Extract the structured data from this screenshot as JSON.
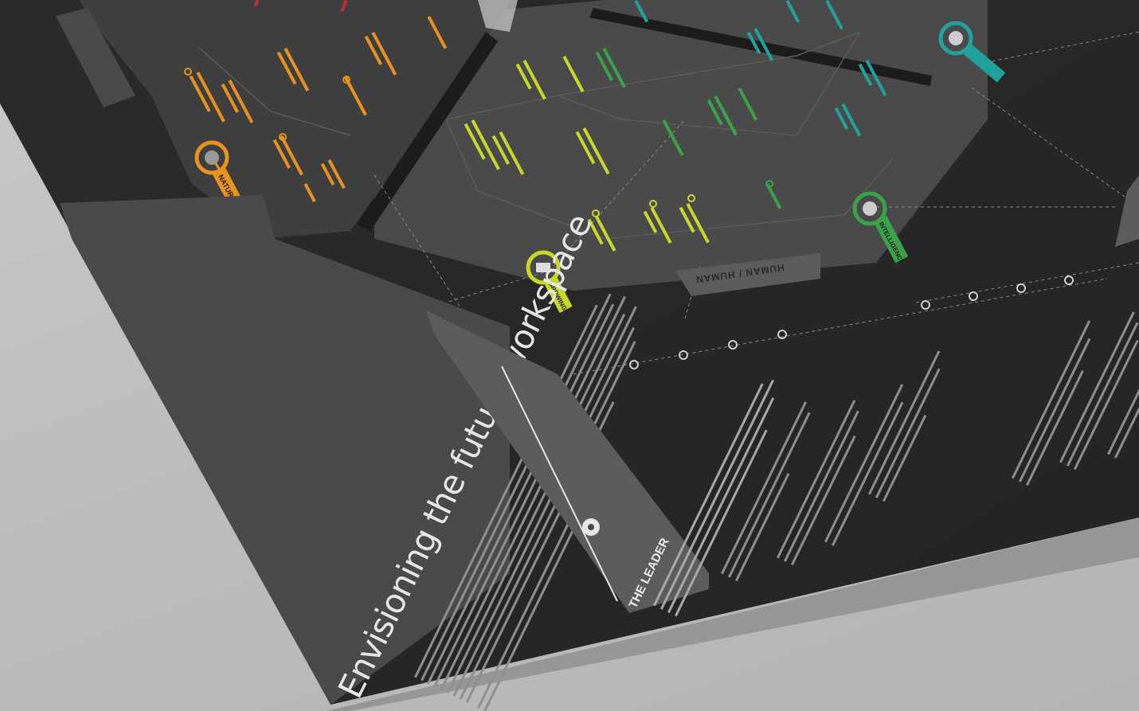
{
  "poster": {
    "title": "Envisioning the future workspace",
    "section_leader": "THE LEADER",
    "label_human": "HUMAN / HUMAN",
    "label_natural_user": "NATURAL USER INTERFACE",
    "label_growing": "GROWING",
    "label_intelligence": "INTELLIGENCE"
  },
  "colors": {
    "paper": "#2c2c2c",
    "panel": "#4a4a4a",
    "panel_light": "#5c5c5c",
    "orange": "#e8921f",
    "lime": "#c9d62a",
    "green": "#3aa34a",
    "teal": "#20a39a",
    "background": "#c4c4c2"
  }
}
